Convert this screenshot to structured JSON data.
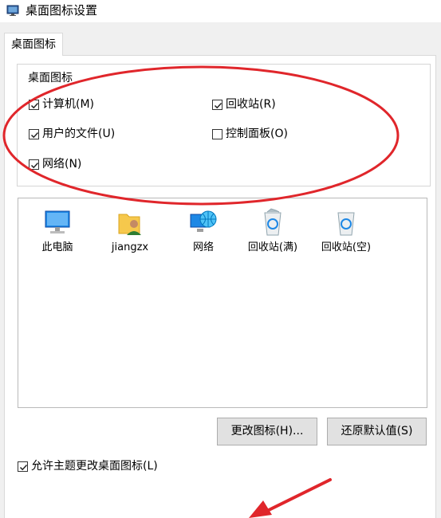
{
  "window": {
    "title": "桌面图标设置",
    "icon": "desktop-monitor-icon"
  },
  "tabs": [
    {
      "label": "桌面图标"
    }
  ],
  "desktop_icons_group": {
    "label": "桌面图标",
    "checkboxes": [
      {
        "label": "计算机(M)",
        "checked": true
      },
      {
        "label": "回收站(R)",
        "checked": true
      },
      {
        "label": "用户的文件(U)",
        "checked": true
      },
      {
        "label": "控制面板(O)",
        "checked": false
      },
      {
        "label": "网络(N)",
        "checked": true
      }
    ]
  },
  "icon_list": [
    {
      "label": "此电脑",
      "icon": "computer-icon"
    },
    {
      "label": "jiangzx",
      "icon": "user-folder-icon"
    },
    {
      "label": "网络",
      "icon": "network-icon"
    },
    {
      "label": "回收站(满)",
      "icon": "recycle-bin-full-icon"
    },
    {
      "label": "回收站(空)",
      "icon": "recycle-bin-empty-icon"
    }
  ],
  "buttons": {
    "change_icon": "更改图标(H)...",
    "restore_default": "还原默认值(S)"
  },
  "allow_theme": {
    "label": "允许主题更改桌面图标(L)",
    "checked": true
  },
  "colors": {
    "annotation": "#e0262b",
    "window_bg": "#f0f0f0",
    "panel_bg": "#ffffff"
  }
}
